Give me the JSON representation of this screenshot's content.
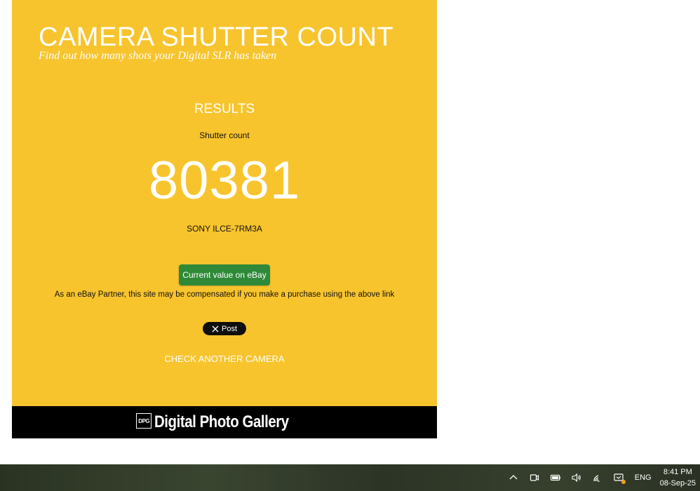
{
  "site": {
    "title": "CAMERA SHUTTER COUNT",
    "subtitle": "Find out how many shots your Digital SLR has taken"
  },
  "results": {
    "heading": "RESULTS",
    "shutter_label": "Shutter count",
    "shutter_value": "80381",
    "camera_model": "SONY ILCE-7RM3A",
    "ebay_button_label": "Current value on eBay",
    "disclaimer": "As an eBay Partner, this site may be compensated if you make a purchase using the above link",
    "x_post_label": "Post",
    "check_another_label": "CHECK ANOTHER CAMERA"
  },
  "footer": {
    "logo_text": "DPG",
    "brand": "Digital Photo Gallery"
  },
  "colors": {
    "panel_background": "#f8c42d",
    "ebay_button": "#2e8a38",
    "footer_background": "#000000"
  },
  "taskbar": {
    "tray_icons": [
      "chevron-up-icon",
      "meet-now-icon",
      "battery-icon",
      "volume-icon",
      "wifi-icon",
      "notification-icon"
    ],
    "language": "ENG",
    "time": "8:41 PM",
    "date": "08-Sep-25"
  }
}
